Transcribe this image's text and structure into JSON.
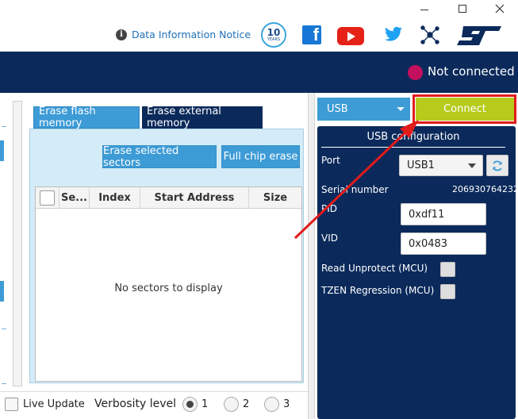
{
  "window": {
    "controls": [
      "minimize",
      "maximize",
      "close"
    ]
  },
  "toolbar": {
    "info_notice": "Data Information Notice",
    "badge_number": "10",
    "badge_sub": "YEARS",
    "facebook_glyph": "f"
  },
  "connection": {
    "status": "Not connected",
    "status_color": "#c3105e"
  },
  "erase": {
    "tabs": [
      {
        "label": "Erase flash memory",
        "active": true
      },
      {
        "label": "Erase external memory",
        "active": false
      }
    ],
    "erase_selected_label": "Erase selected sectors",
    "full_chip_label": "Full chip erase",
    "columns": [
      "Se...",
      "Index",
      "Start Address",
      "Size"
    ],
    "empty_message": "No sectors to display"
  },
  "bottom": {
    "live_update_label": "Live Update",
    "verbosity_label": "Verbosity level",
    "verbosity_levels": [
      "1",
      "2",
      "3"
    ],
    "verbosity_selected": "1"
  },
  "interface": {
    "selected": "USB",
    "connect_label": "Connect",
    "config_title": "USB configuration",
    "port_label": "Port",
    "port_value": "USB1",
    "serial_label": "Serial number",
    "serial_value": "206930764232",
    "pid_label": "PID",
    "pid_value": "0xdf11",
    "vid_label": "VID",
    "vid_value": "0x0483",
    "read_unprotect_label": "Read Unprotect (MCU)",
    "tzen_label": "TZEN Regression (MCU)"
  },
  "colors": {
    "navy": "#0b2a5b",
    "accent_blue": "#3d9bd6",
    "connect_green": "#b7cb1d",
    "highlight_red": "#e21b1b"
  }
}
